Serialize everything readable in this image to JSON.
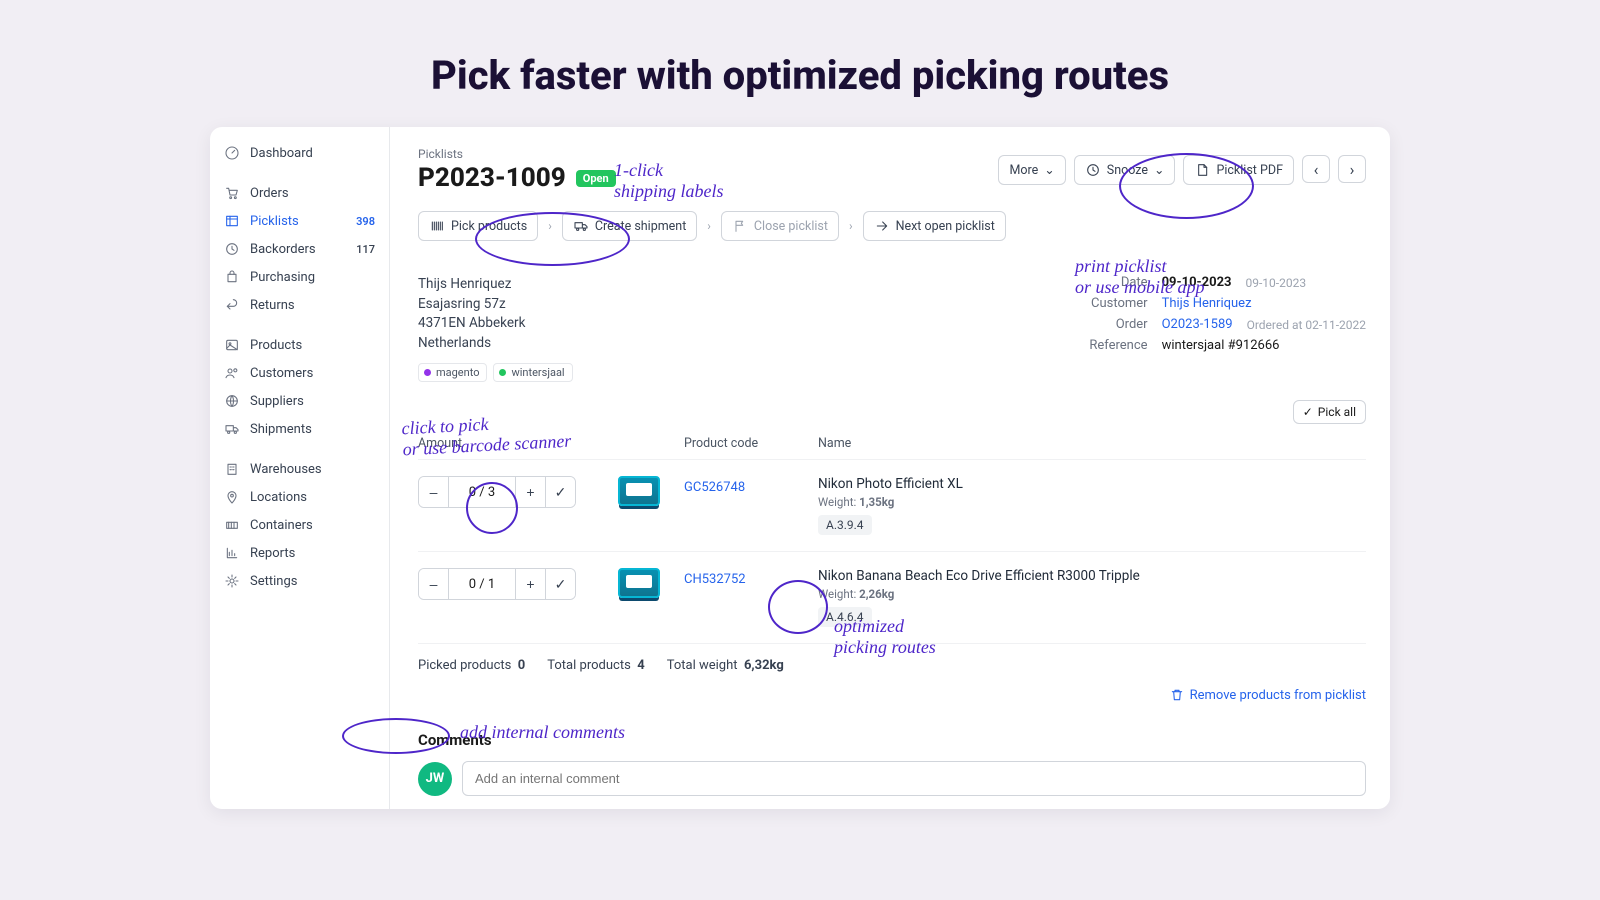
{
  "headline": "Pick faster with optimized picking routes",
  "nav": {
    "dashboard": "Dashboard",
    "orders": "Orders",
    "picklists": "Picklists",
    "picklists_count": "398",
    "backorders": "Backorders",
    "backorders_count": "117",
    "purchasing": "Purchasing",
    "returns": "Returns",
    "products": "Products",
    "customers": "Customers",
    "suppliers": "Suppliers",
    "shipments": "Shipments",
    "warehouses": "Warehouses",
    "locations": "Locations",
    "containers": "Containers",
    "reports": "Reports",
    "settings": "Settings"
  },
  "crumb": "Picklists",
  "title": "P2023-1009",
  "status": "Open",
  "actions": {
    "more": "More",
    "snooze": "Snooze",
    "pdf": "Picklist PDF"
  },
  "steps": {
    "pick": "Pick products",
    "create": "Create shipment",
    "close": "Close picklist",
    "next": "Next open picklist"
  },
  "address": {
    "name": "Thijs Henriquez",
    "street": "Esajasring 57z",
    "city": "4371EN Abbekerk",
    "country": "Netherlands"
  },
  "tags": {
    "t1": "magento",
    "t2": "wintersjaal"
  },
  "meta": {
    "date_label": "Date",
    "date": "09-10-2023",
    "date_sub": "09-10-2023",
    "customer_label": "Customer",
    "customer": "Thijs Henriquez",
    "order_label": "Order",
    "order": "O2023-1589",
    "order_sub": "Ordered at 02-11-2022",
    "ref_label": "Reference",
    "ref": "wintersjaal #912666"
  },
  "pickall": "Pick all",
  "headers": {
    "amount": "Amount",
    "code": "Product code",
    "name": "Name"
  },
  "rows": [
    {
      "qty": "0 / 3",
      "code": "GC526748",
      "name": "Nikon Photo Efficient XL",
      "weight_label": "Weight:",
      "weight": "1,35kg",
      "loc": "A.3.9.4"
    },
    {
      "qty": "0 / 1",
      "code": "CH532752",
      "name": "Nikon Banana Beach Eco Drive Efficient R3000 Tripple",
      "weight_label": "Weight:",
      "weight": "2,26kg",
      "loc": "A.4.6.4"
    }
  ],
  "totals": {
    "picked_label": "Picked products",
    "picked": "0",
    "total_label": "Total products",
    "total": "4",
    "weight_label": "Total weight",
    "weight": "6,32kg"
  },
  "remove": "Remove products from picklist",
  "comments_heading": "Comments",
  "avatar": "JW",
  "comment_placeholder": "Add an internal comment",
  "notes": {
    "n1": "1-click\nshipping labels",
    "n2": "print picklist\nor use mobile app",
    "n3": "click to pick\nor use barcode scanner",
    "n4": "optimized\npicking routes",
    "n5": "add internal comments"
  }
}
